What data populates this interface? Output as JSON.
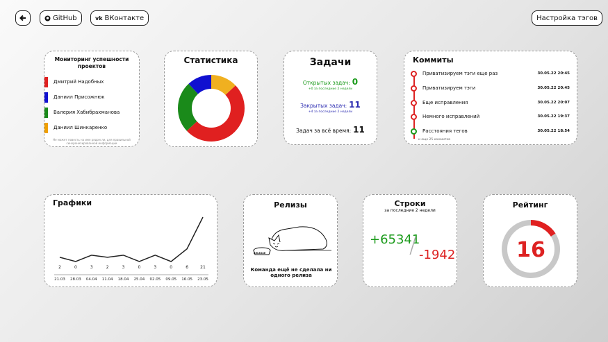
{
  "header": {
    "back_icon": "arrow-left-icon",
    "github_label": "GitHub",
    "vk_label": "ВКонтакте",
    "tags_label": "Настройка тэгов"
  },
  "monitoring": {
    "title": "Мониторинг успешности проектов",
    "members": [
      {
        "name": "Дмитрий Надобных",
        "color": "#e02020"
      },
      {
        "name": "Даниил Присожнюк",
        "color": "#1010d0"
      },
      {
        "name": "Валерия Хабибрахманова",
        "color": "#1a8a1a"
      },
      {
        "name": "Даниил Шинкаренко",
        "color": "#f0a000"
      }
    ],
    "footer": "Не может повесть на имя рядом ли, для правильной синхронизированной информации"
  },
  "stats": {
    "title": "Статистика",
    "slices": [
      {
        "label": "Дмитрий Надобных",
        "value": 50,
        "color": "#e02020"
      },
      {
        "label": "Даниил Присожнюк",
        "value": 12,
        "color": "#1010d0"
      },
      {
        "label": "Валерия Хабибрахманова",
        "value": 25,
        "color": "#1a8a1a"
      },
      {
        "label": "Даниил Шинкаренко",
        "value": 13,
        "color": "#f0b020"
      }
    ]
  },
  "tasks": {
    "title": "Задачи",
    "open_label": "Открытых задач:",
    "open_value": "0",
    "open_sub": "+0 за последние 2 недели",
    "closed_label": "Закрытых задач:",
    "closed_value": "11",
    "closed_sub": "+4 за последние 2 недели",
    "all_label": "Задач за всё время:",
    "all_value": "11"
  },
  "commits": {
    "title": "Коммиты",
    "items": [
      {
        "message": "Приватизируем тэги еще раз",
        "date": "30.05.22 20:45",
        "color": "red"
      },
      {
        "message": "Приватизируем тэги",
        "date": "30.05.22 20:45",
        "color": "red"
      },
      {
        "message": "Еще исправления",
        "date": "30.05.22 20:07",
        "color": "red"
      },
      {
        "message": "Немного исправлений",
        "date": "30.05.22 19:37",
        "color": "red"
      },
      {
        "message": "Расстояния тегов",
        "date": "30.05.22 18:54",
        "color": "green"
      }
    ],
    "more": "и еще 25 коммитов"
  },
  "graph": {
    "title": "Графики",
    "chart_data": {
      "type": "line",
      "categories": [
        "21.03",
        "28.03",
        "04.04",
        "11.04",
        "18.04",
        "25.04",
        "02.05",
        "09.05",
        "16.05",
        "23.05"
      ],
      "values": [
        2,
        0,
        3,
        2,
        3,
        0,
        3,
        0,
        6,
        21
      ],
      "title": "Графики",
      "color": "#222222"
    }
  },
  "releases": {
    "title": "Релизы",
    "bowl_label": "RELEASE",
    "message": "Команда ещё не сделала ни одного релиза"
  },
  "lines": {
    "title": "Строки",
    "subtitle": "за последние 2 недели",
    "added": "+65341",
    "removed": "-1942"
  },
  "rating": {
    "title": "Рейтинг",
    "value": "16",
    "fraction": 0.16,
    "color": "#e02020"
  }
}
